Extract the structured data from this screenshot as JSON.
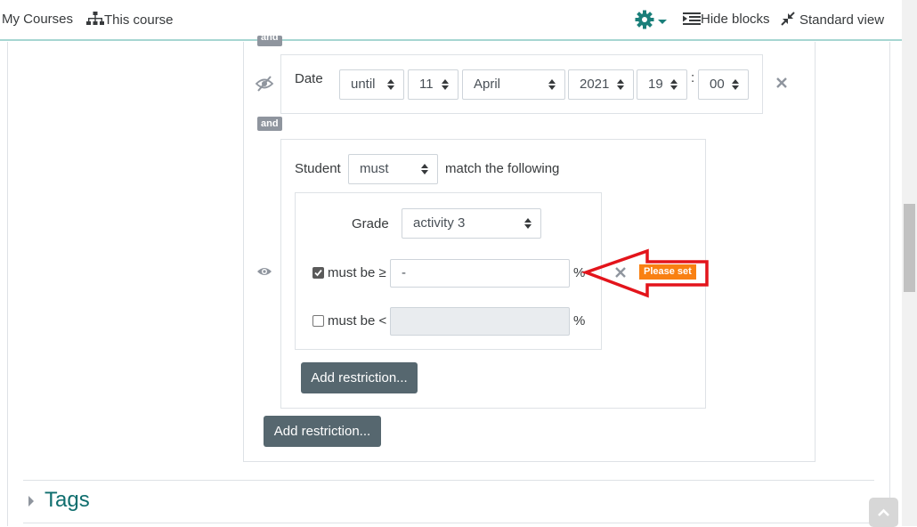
{
  "topbar": {
    "my_courses": "My Courses",
    "this_course": "This course",
    "hide_blocks": "Hide blocks",
    "standard_view": "Standard view",
    "colors": {
      "accent": "#1a7f7a",
      "border": "#a6d6d2"
    }
  },
  "restrictions": {
    "date": {
      "label": "Date",
      "direction": "until",
      "day": "11",
      "month": "April",
      "year": "2021",
      "hour": "19",
      "separator": ":",
      "minute": "00"
    },
    "and_label": "and",
    "set": {
      "student_label": "Student",
      "must": "must",
      "match_label": "match the following",
      "grade": {
        "label": "Grade",
        "activity": "activity 3",
        "min": {
          "label": "must be ≥",
          "checked": true,
          "value": "-",
          "unit": "%"
        },
        "max": {
          "label": "must be <",
          "checked": false,
          "value": "",
          "unit": "%"
        }
      },
      "please_set": "Please set",
      "inner_add_button": "Add restriction..."
    },
    "outer_add_button": "Add restriction..."
  },
  "tags": {
    "title": "Tags",
    "color": "#0f6e6e"
  },
  "annotation": {
    "arrow_color": "#e3141b",
    "badge_color": "#f98012"
  }
}
